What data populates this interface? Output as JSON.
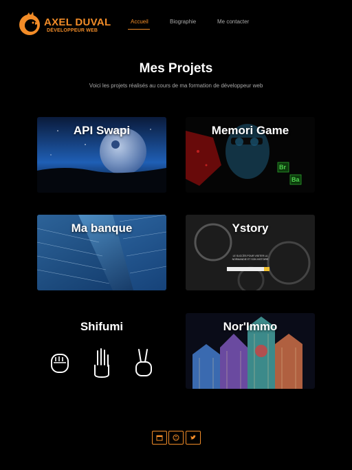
{
  "header": {
    "logo_title": "AXEL DUVAL",
    "logo_subtitle": "DÉVELOPPEUR WEB",
    "nav": [
      {
        "label": "Accueil",
        "active": true
      },
      {
        "label": "Biographie",
        "active": false
      },
      {
        "label": "Me contacter",
        "active": false
      }
    ]
  },
  "main": {
    "title": "Mes Projets",
    "subtitle": "Voici les projets réalisés au cours de ma formation de développeur web",
    "projects": [
      {
        "title": "API Swapi"
      },
      {
        "title": "Memori Game",
        "badge_top": "Br",
        "badge_bottom": "Ba"
      },
      {
        "title": "Ma banque"
      },
      {
        "title": "Ystory",
        "overlay_text": "LE SUCCÈS POUR VISITER LA NORMANDIE ET SON HISTOIRE"
      },
      {
        "title": "Shifumi"
      },
      {
        "title": "Nor'Immo"
      }
    ]
  },
  "footer": {
    "social": [
      "calendar-icon",
      "github-icon",
      "twitter-icon"
    ]
  },
  "colors": {
    "accent": "#f28c28",
    "background": "#000000"
  }
}
